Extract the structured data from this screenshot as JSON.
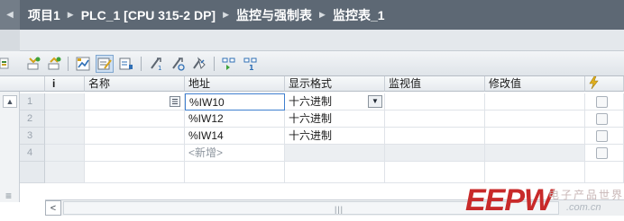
{
  "breadcrumb": {
    "items": [
      "项目1",
      "PLC_1 [CPU 315-2 DP]",
      "监控与强制表",
      "监控表_1"
    ]
  },
  "toolbar": {
    "icons": [
      "insert-row-icon",
      "add-row-icon",
      "show-all-icon",
      "monitor-icon",
      "force-icon",
      "modify-now-icon",
      "modify-trigger-icon",
      "enable-peripheral-icon",
      "monitor-all-icon",
      "monitor-once-icon"
    ]
  },
  "table": {
    "columns": [
      "i",
      "名称",
      "地址",
      "显示格式",
      "监视值",
      "修改值"
    ],
    "rows": [
      {
        "num": "1",
        "address": "%IW10",
        "format": "十六进制"
      },
      {
        "num": "2",
        "address": "%IW12",
        "format": "十六进制"
      },
      {
        "num": "3",
        "address": "%IW14",
        "format": "十六进制"
      },
      {
        "num": "4",
        "address": "<新增>",
        "format": ""
      }
    ]
  },
  "watermark": {
    "logo": "EEPW",
    "chinese": "电子产品世界",
    "domain": ".com.cn"
  },
  "colors": {
    "titlebar": "#5d6874",
    "accent_red": "#c82a2a",
    "selection_border": "#3f7fcf"
  }
}
